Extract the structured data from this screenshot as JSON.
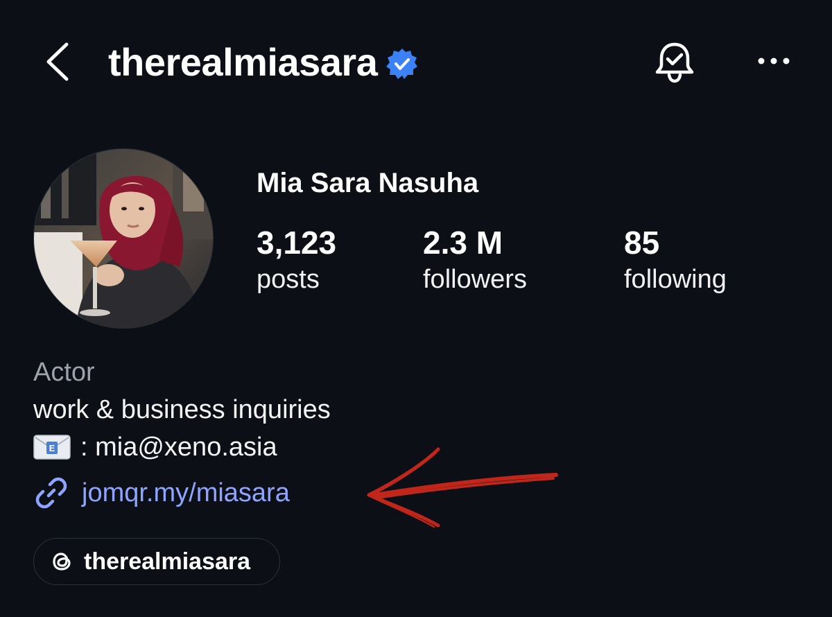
{
  "header": {
    "username": "therealmiasara",
    "verified": true
  },
  "profile": {
    "display_name": "Mia Sara Nasuha",
    "stats": [
      {
        "value": "3,123",
        "label": "posts"
      },
      {
        "value": "2.3 M",
        "label": "followers"
      },
      {
        "value": "85",
        "label": "following"
      }
    ]
  },
  "bio": {
    "category": "Actor",
    "line1": "work & business inquiries",
    "email_line": ": mia@xeno.asia",
    "link": "jomqr.my/miasara"
  },
  "threads": {
    "label": "therealmiasara"
  },
  "colors": {
    "background": "#0c1016",
    "link": "#8ea4ff",
    "verified": "#3b82f6",
    "annotation": "#c0261a"
  },
  "icons": {
    "back": "chevron-left-icon",
    "verified": "verified-badge-icon",
    "bell": "bell-check-icon",
    "more": "more-horizontal-icon",
    "link": "link-icon",
    "threads": "threads-icon",
    "email": "envelope-emoji-icon"
  }
}
